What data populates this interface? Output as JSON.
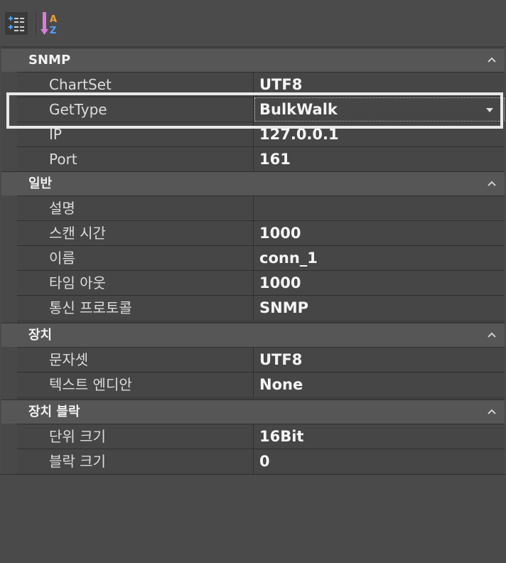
{
  "toolbar": {
    "categorized_icon": "categorized-view-icon",
    "alphabetical_icon": "alphabetical-sort-icon"
  },
  "sections": [
    {
      "title": "SNMP",
      "rows": [
        {
          "name": "ChartSet",
          "value": "UTF8"
        },
        {
          "name": "GetType",
          "value": "BulkWalk"
        },
        {
          "name": "IP",
          "value": "127.0.0.1"
        },
        {
          "name": "Port",
          "value": "161"
        }
      ]
    },
    {
      "title": "일반",
      "rows": [
        {
          "name": "설명",
          "value": ""
        },
        {
          "name": "스캔 시간",
          "value": "1000"
        },
        {
          "name": "이름",
          "value": "conn_1"
        },
        {
          "name": "타임 아웃",
          "value": "1000"
        },
        {
          "name": "통신 프로토콜",
          "value": "SNMP"
        }
      ]
    },
    {
      "title": "장치",
      "rows": [
        {
          "name": "문자셋",
          "value": "UTF8"
        },
        {
          "name": "텍스트 엔디안",
          "value": "None"
        }
      ]
    },
    {
      "title": "장치 블락",
      "rows": [
        {
          "name": "단위 크기",
          "value": "16Bit"
        },
        {
          "name": "블락 크기",
          "value": "0"
        }
      ]
    }
  ],
  "colors": {
    "background": "#4a4a4a",
    "category": "#565656",
    "row": "#464646",
    "highlight": "#e8e8e8"
  }
}
